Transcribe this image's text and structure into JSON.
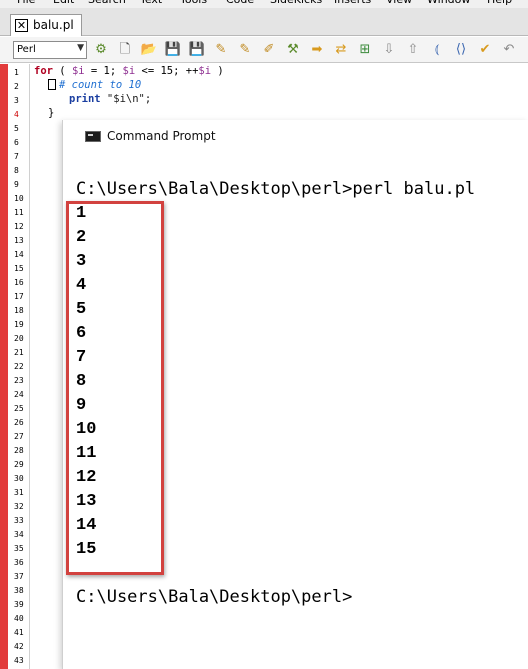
{
  "menu": [
    "File",
    "Edit",
    "Search",
    "Text",
    "Tools",
    "Code",
    "SideKicks",
    "Inserts",
    "View",
    "Window",
    "Help"
  ],
  "tab": {
    "label": "balu.pl"
  },
  "toolbar": {
    "mode_value": "Perl"
  },
  "editor": {
    "line_numbers": [
      "1",
      "2",
      "3",
      "4",
      "5",
      "6",
      "7",
      "8",
      "9",
      "10",
      "11",
      "12",
      "13",
      "14",
      "15",
      "16",
      "17",
      "18",
      "19",
      "20",
      "21",
      "22",
      "23",
      "24",
      "25",
      "26",
      "27",
      "28",
      "29",
      "30",
      "31",
      "32",
      "33",
      "34",
      "35",
      "36",
      "37",
      "38",
      "39",
      "40",
      "41",
      "42",
      "43"
    ],
    "lines": [
      {
        "tokens": [
          {
            "t": "for",
            "c": "kw"
          },
          {
            "t": " ( ",
            "c": ""
          },
          {
            "t": "$i",
            "c": "var"
          },
          {
            "t": " = 1; ",
            "c": ""
          },
          {
            "t": "$i",
            "c": "var"
          },
          {
            "t": " <= 15; ++",
            "c": ""
          },
          {
            "t": "$i",
            "c": "var"
          },
          {
            "t": " )",
            "c": ""
          }
        ]
      },
      {
        "tokens": [
          {
            "t": "# count to 10",
            "c": "cmt"
          }
        ]
      },
      {
        "tokens": [
          {
            "t": "print",
            "c": "fn"
          },
          {
            "t": " \"$i\\n\";",
            "c": "str"
          }
        ]
      },
      {
        "tokens": [
          {
            "t": "}",
            "c": ""
          }
        ]
      }
    ]
  },
  "cmd": {
    "title": "Command Prompt",
    "prompt_command": "C:\\Users\\Bala\\Desktop\\perl>perl balu.pl",
    "output": [
      "1",
      "2",
      "3",
      "4",
      "5",
      "6",
      "7",
      "8",
      "9",
      "10",
      "11",
      "12",
      "13",
      "14",
      "15"
    ],
    "prompt_end": "C:\\Users\\Bala\\Desktop\\perl>"
  },
  "colors": {
    "gutter_bar": "#e23b3b",
    "highlight_box": "#d2423f"
  }
}
